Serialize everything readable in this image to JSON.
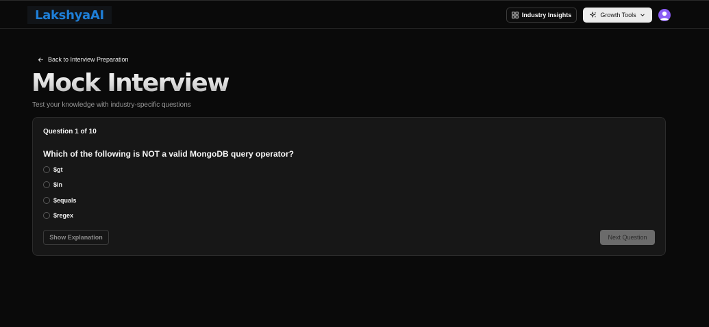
{
  "header": {
    "logo_text": "LakshyaAI",
    "insights_label": "Industry Insights",
    "growth_label": "Growth Tools",
    "accent_logo": "#1e7fd8",
    "avatar_color": "#8b5cf6"
  },
  "nav": {
    "back_label": "Back to Interview Preparation"
  },
  "page": {
    "title": "Mock Interview",
    "subtitle": "Test your knowledge with industry-specific questions"
  },
  "quiz": {
    "counter": "Question 1 of 10",
    "question": "Which of the following is NOT a valid MongoDB query operator?",
    "options": [
      "$gt",
      "$in",
      "$equals",
      "$regex"
    ],
    "selected_option": null,
    "explain_label": "Show Explanation",
    "next_label": "Next Question"
  },
  "icons": {
    "insights": "grid-icon",
    "growth": "sparkles-icon",
    "dropdown": "chevron-down-icon",
    "back": "arrow-left-icon",
    "avatar": "user-icon"
  }
}
